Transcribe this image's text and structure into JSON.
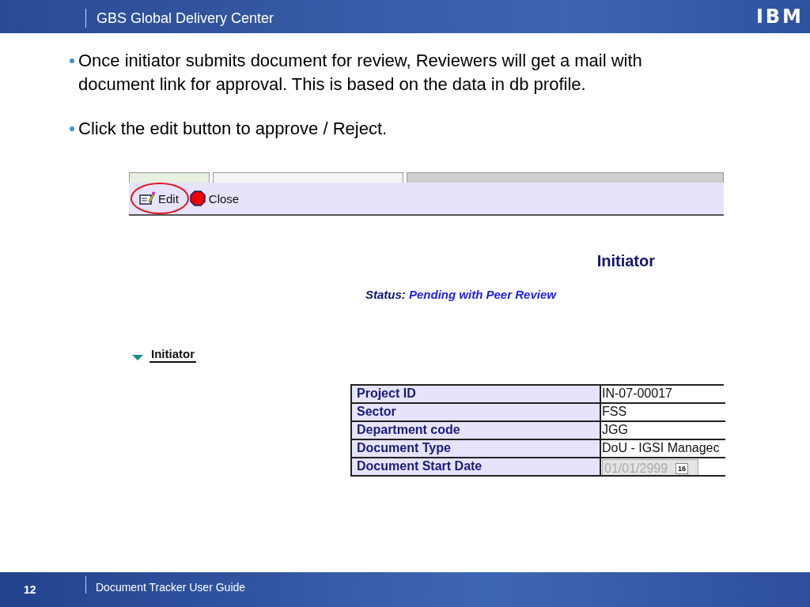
{
  "header": {
    "title": "GBS Global Delivery Center",
    "logo": "IBM"
  },
  "bullets": [
    "Once initiator submits document for review, Reviewers will get a mail with document link for approval. This is based on the data in db profile.",
    "Click the edit button to approve / Reject."
  ],
  "screenshot": {
    "toolbar": [
      {
        "kind": "edit",
        "label": "Edit",
        "highlighted": true
      },
      {
        "kind": "close",
        "label": "Close",
        "highlighted": false
      }
    ],
    "form_title": "Initiator",
    "status": {
      "label": "Status:",
      "value": "Pending with Peer Review"
    },
    "section": {
      "title": "Initiator",
      "expanded": true
    },
    "fields": [
      {
        "kind": "text",
        "label": "Project ID",
        "value": "IN-07-00017"
      },
      {
        "kind": "text",
        "label": "Sector",
        "value": "FSS"
      },
      {
        "kind": "text",
        "label": "Department code",
        "value": "JGG"
      },
      {
        "kind": "text",
        "label": "Document Type",
        "value": "DoU - IGSI Managec"
      },
      {
        "kind": "date",
        "label": "Document Start Date",
        "value": "01/01/2999",
        "calendar_label": "16"
      }
    ]
  },
  "footer": {
    "page": "12",
    "title": "Document Tracker User Guide"
  }
}
